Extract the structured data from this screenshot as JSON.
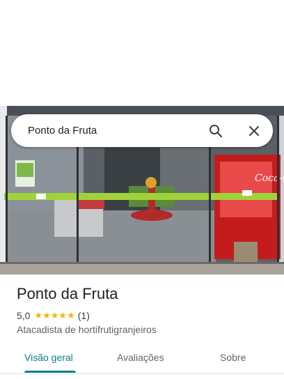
{
  "search": {
    "query": "Ponto da Fruta",
    "search_icon": "search-icon",
    "close_icon": "close-icon"
  },
  "place": {
    "name": "Ponto da Fruta",
    "rating": "5,0",
    "stars": "★★★★★",
    "review_count": "(1)",
    "category": "Atacadista de hortifrutigranjeiros"
  },
  "photo": {
    "sign_text": "Coca-Cola",
    "description_icon": "storefront-photo"
  },
  "tabs": [
    {
      "label": "Visão geral",
      "active": true
    },
    {
      "label": "Avaliações",
      "active": false
    },
    {
      "label": "Sobre",
      "active": false
    }
  ],
  "colors": {
    "accent": "#0b7f8a",
    "star": "#f4b400",
    "fascia_green": "#9fd33a",
    "coke_red": "#c41c1c"
  }
}
